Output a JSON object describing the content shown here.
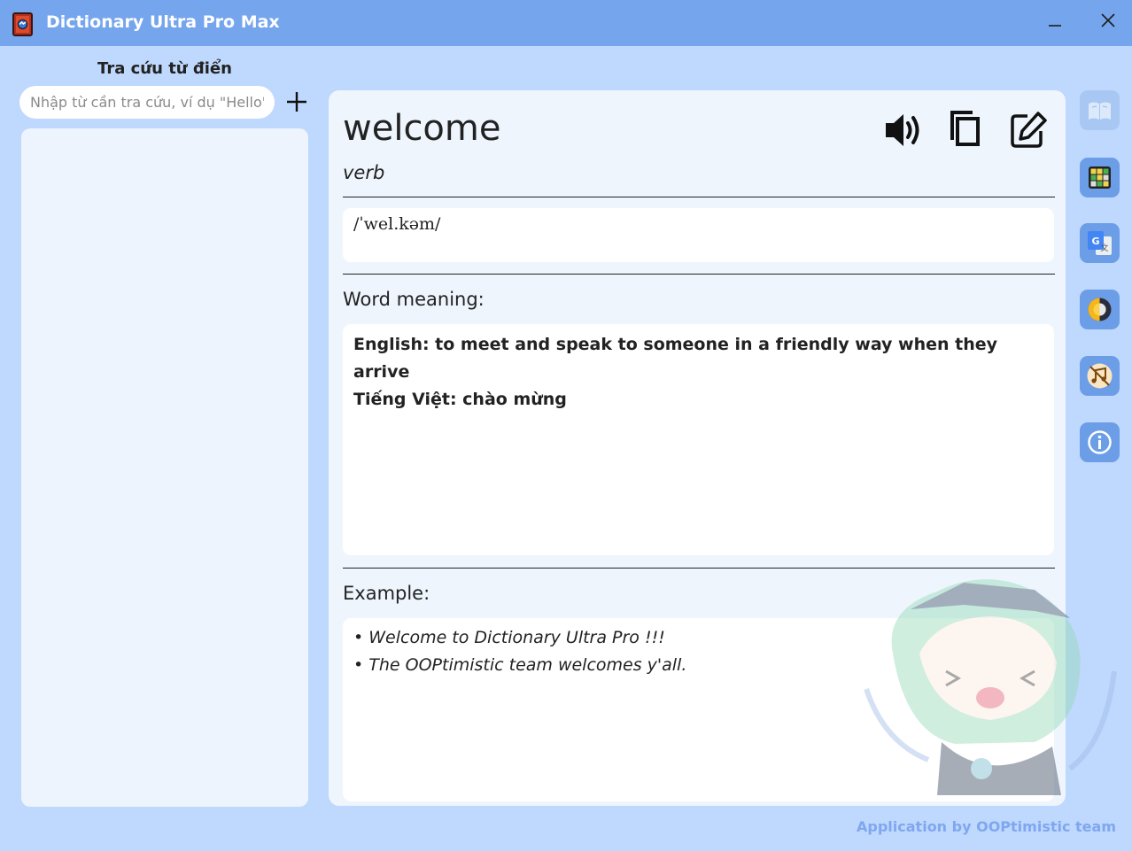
{
  "window": {
    "title": "Dictionary Ultra Pro Max",
    "app_icon": "book-icon",
    "controls": [
      "minimize-icon",
      "close-icon"
    ]
  },
  "sidebar": {
    "heading": "Tra cứu từ điển",
    "search_placeholder": "Nhập từ cần tra cứu, ví dụ \"Hello\"",
    "search_value": "",
    "add_icon": "plus-icon"
  },
  "entry": {
    "word": "welcome",
    "part_of_speech": "verb",
    "phonetic": "/ˈwel.kəm/",
    "actions": [
      "speaker-icon",
      "copy-icon",
      "edit-icon"
    ],
    "meaning_label": "Word meaning:",
    "meaning_lines": [
      "English: to meet and speak to someone in a friendly way when they arrive",
      "Tiếng Việt: chào mừng"
    ],
    "example_label": "Example:",
    "example_lines": [
      "• Welcome to Dictionary Ultra Pro !!!",
      "• The OOPtimistic team welcomes y'all."
    ]
  },
  "right_toolbar": [
    {
      "icon": "dictionary-book-icon",
      "active": true
    },
    {
      "icon": "game-grid-icon",
      "active": false
    },
    {
      "icon": "google-translate-icon",
      "active": false
    },
    {
      "icon": "theme-toggle-icon",
      "active": false
    },
    {
      "icon": "music-toggle-icon",
      "active": false
    },
    {
      "icon": "info-icon",
      "active": false
    }
  ],
  "footer": "Application by OOPtimistic team",
  "colors": {
    "background": "#bfd8fd",
    "titlebar": "#75a5ec",
    "panel": "#eef5fd",
    "accent_button": "#6c9ee8",
    "footer_text": "#7fa7f0"
  }
}
